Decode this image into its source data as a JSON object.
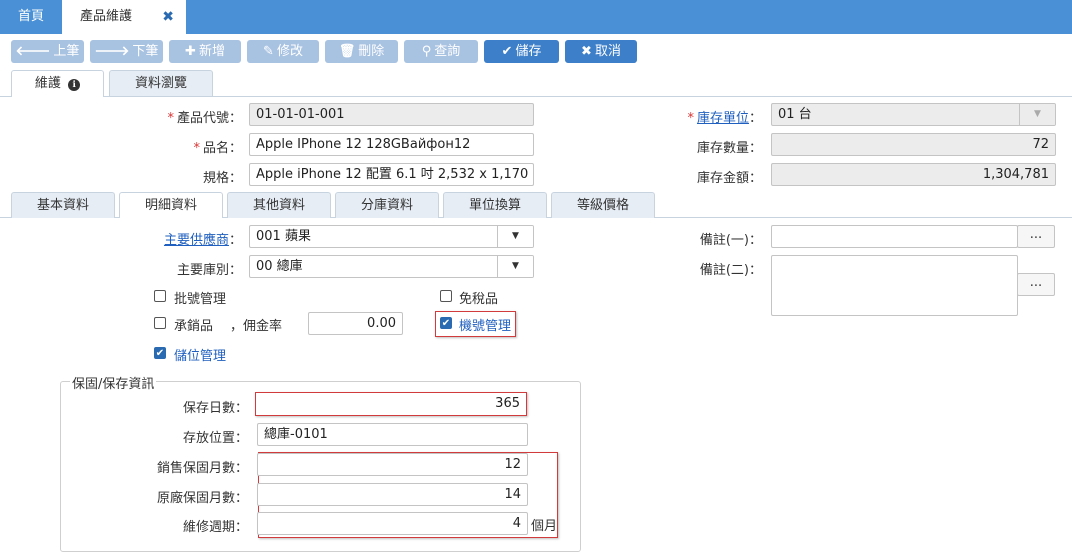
{
  "tabs": {
    "home": "首頁",
    "active": "產品維護",
    "close": "✖"
  },
  "toolbar": {
    "prev": {
      "icon": "🡐",
      "label": "上筆"
    },
    "next": {
      "icon": "🡒",
      "label": "下筆"
    },
    "add": {
      "icon": "✚",
      "label": "新增"
    },
    "edit": {
      "icon": "✎",
      "label": "修改"
    },
    "delete": {
      "icon": "🗑",
      "label": "刪除"
    },
    "query": {
      "icon": "⚲",
      "label": "查詢"
    },
    "save": {
      "icon": "✔",
      "label": "儲存"
    },
    "cancel": {
      "icon": "✖",
      "label": "取消"
    }
  },
  "view_tabs": {
    "maintain": "維護",
    "maintain_icon": "ℹ",
    "browse": "資料瀏覽"
  },
  "header": {
    "code_label": "產品代號：",
    "code": "01-01-01-001",
    "name_label": "品名：",
    "name": "Apple IPhone 12 128GВайфон12",
    "spec_label": "規格：",
    "spec": "Apple iPhone 12 配置 6.1 吋 2,532 x 1,170",
    "unit_label": "庫存單位",
    "unit_colon": "：",
    "unit": "01 台",
    "qty_label": "庫存數量：",
    "qty": "72",
    "amount_label": "庫存金額：",
    "amount": "1,304,781"
  },
  "detail_tabs": [
    "基本資料",
    "明細資料",
    "其他資料",
    "分庫資料",
    "單位換算",
    "等級價格"
  ],
  "detail": {
    "supplier_label": "主要供應商",
    "supplier_colon": "：",
    "supplier": "001 蘋果",
    "warehouse_label": "主要庫別：",
    "warehouse": "00 總庫",
    "batch_label": "批號管理",
    "consign_label": "承銷品",
    "commission_label": "，佣金率",
    "commission": "0.00",
    "bin_label": "儲位管理",
    "taxfree_label": "免稅品",
    "serial_label": "機號管理",
    "remark1_label": "備註(一)：",
    "remark2_label": "備註(二)：",
    "ellipsis": "..."
  },
  "warranty": {
    "legend": "保固/保存資訊",
    "shelf_label": "保存日數：",
    "shelf": "365",
    "location_label": "存放位置：",
    "location": "總庫-0101",
    "sales_label": "銷售保固月數：",
    "sales": "12",
    "factory_label": "原廠保固月數：",
    "factory": "14",
    "repair_label": "維修週期：",
    "repair": "4",
    "unit": "個月"
  },
  "icons": {
    "dropdown": "▼",
    "check": "✔"
  }
}
